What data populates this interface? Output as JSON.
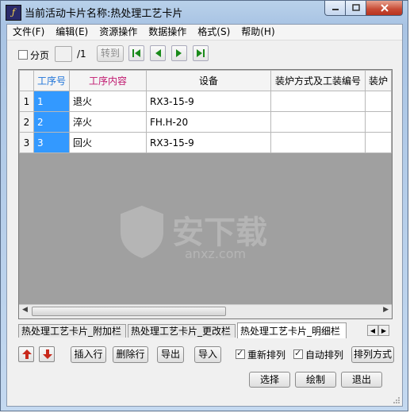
{
  "window": {
    "title": "当前活动卡片名称:热处理工艺卡片"
  },
  "menu": [
    {
      "label": "文件(F)"
    },
    {
      "label": "编辑(E)"
    },
    {
      "label": "资源操作"
    },
    {
      "label": "数据操作"
    },
    {
      "label": "格式(S)"
    },
    {
      "label": "帮助(H)"
    }
  ],
  "toolbar": {
    "paging_label": "分页",
    "paging_checked": false,
    "page_total": "/1",
    "goto_label": "转到"
  },
  "grid": {
    "columns": [
      "工序号",
      "工序内容",
      "设备",
      "装炉方式及工装编号",
      "装炉"
    ],
    "header_colors": {
      "工序号": "#1e73d8",
      "工序内容": "#c0166e"
    },
    "rows": [
      {
        "num": "1",
        "seq": "1",
        "content": "退火",
        "equipment": "RX3-15-9"
      },
      {
        "num": "2",
        "seq": "2",
        "content": "淬火",
        "equipment": "FH.H-20"
      },
      {
        "num": "3",
        "seq": "3",
        "content": "回火",
        "equipment": "RX3-15-9"
      }
    ],
    "selection_color": "#3399ff"
  },
  "tabs": [
    {
      "label": "热处理工艺卡片_附加栏",
      "active": false
    },
    {
      "label": "热处理工艺卡片_更改栏",
      "active": false
    },
    {
      "label": "热处理工艺卡片_明细栏",
      "active": true
    }
  ],
  "actions": {
    "insert_row": "插入行",
    "delete_row": "删除行",
    "export": "导出",
    "import": "导入",
    "resort_label": "重新排列",
    "resort_checked": true,
    "autosort_label": "自动排列",
    "autosort_checked": true,
    "sort_mode": "排列方式",
    "select": "选择",
    "draw": "绘制",
    "exit": "退出"
  },
  "watermark": {
    "text": "安下载",
    "subtext": "anxz.com"
  },
  "icons": {
    "app": "app-logo-icon",
    "move_up": "arrow-up-icon",
    "move_down": "arrow-down-icon",
    "first": "first-page-icon",
    "prev": "prev-page-icon",
    "next": "next-page-icon",
    "last": "last-page-icon"
  }
}
